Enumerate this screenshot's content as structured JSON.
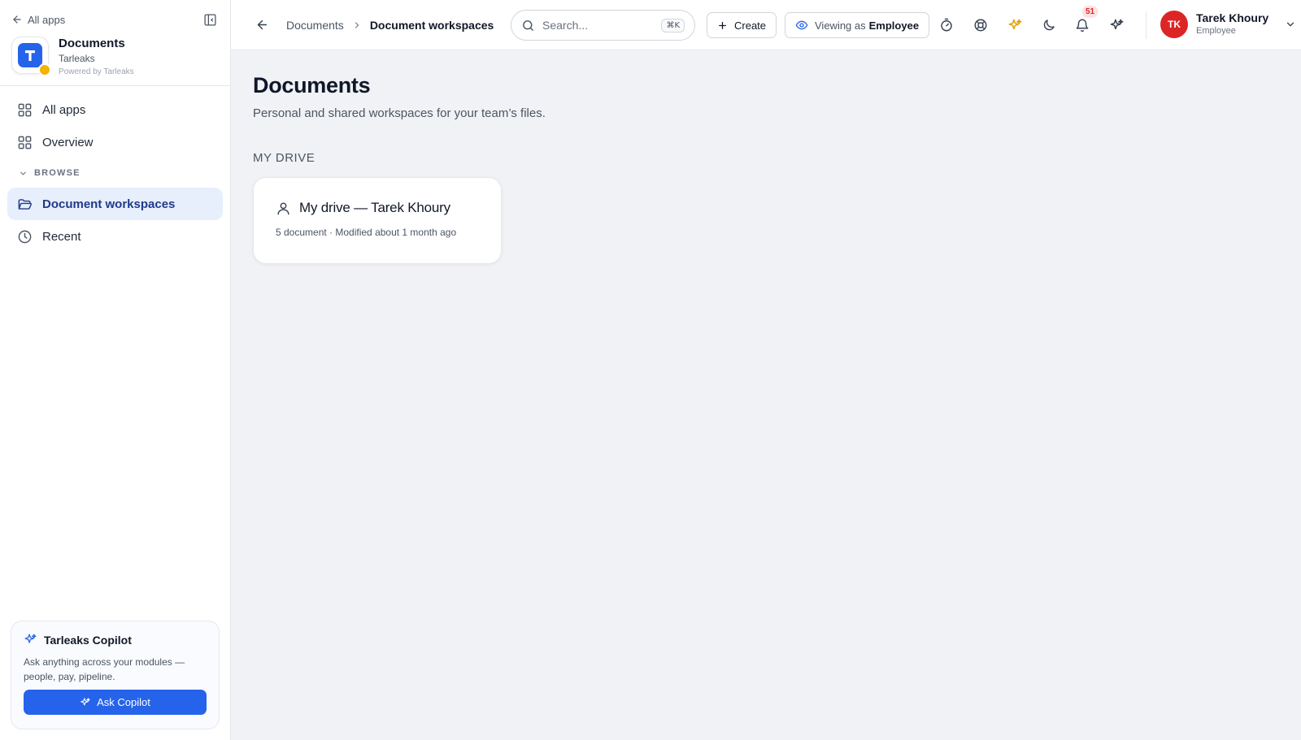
{
  "sidebar": {
    "back_label": "All apps",
    "app": {
      "name": "Documents",
      "org": "Tarleaks",
      "powered_by": "Powered by Tarleaks",
      "logo_letter": "T",
      "brand_color": "#2563eb"
    },
    "nav": {
      "all_apps": "All apps",
      "overview": "Overview",
      "section_browse": "BROWSE",
      "document_workspaces": "Document workspaces",
      "recent": "Recent"
    },
    "copilot": {
      "title": "Tarleaks Copilot",
      "description": "Ask anything across your modules — people, pay, pipeline.",
      "button_label": "Ask Copilot"
    }
  },
  "topbar": {
    "breadcrumb": {
      "parent": "Documents",
      "current": "Document workspaces"
    },
    "search": {
      "placeholder": "Search...",
      "shortcut": "⌘K"
    },
    "create_label": "Create",
    "viewing_as": {
      "prefix": "Viewing as",
      "role": "Employee"
    },
    "notifications_count": "51",
    "user": {
      "initials": "TK",
      "name": "Tarek Khoury",
      "role": "Employee",
      "avatar_color": "#dc2626"
    }
  },
  "page": {
    "title": "Documents",
    "subtitle": "Personal and shared workspaces for your team’s files.",
    "section_label": "MY DRIVE",
    "drive_card": {
      "title": "My drive — Tarek Khoury",
      "meta": "5 document · Modified about 1 month ago"
    }
  },
  "icons": {
    "sidebar": [
      "arrow-left-icon",
      "sidebar-toggle-icon",
      "grid-icon",
      "chevron-down-icon",
      "folder-open-icon",
      "clock-icon",
      "sparkles-icon"
    ],
    "topbar": [
      "arrow-left-icon",
      "chevron-right-icon",
      "search-icon",
      "plus-icon",
      "eye-icon",
      "timer-icon",
      "lifebuoy-icon",
      "sparkle-icon",
      "moon-icon",
      "bell-icon",
      "sparkles-icon",
      "chevron-down-icon"
    ],
    "content": [
      "user-icon"
    ]
  }
}
